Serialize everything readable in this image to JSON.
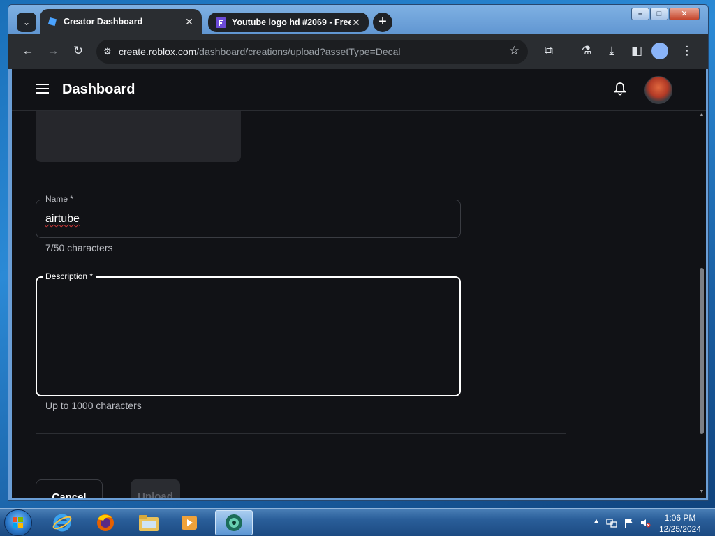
{
  "browser": {
    "tabs": [
      {
        "title": "Creator Dashboard",
        "active": true
      },
      {
        "title": "Youtube logo hd #2069 - Free",
        "active": false
      }
    ],
    "url_host": "create.roblox.com",
    "url_path": "/dashboard/creations/upload?assetType=Decal"
  },
  "header": {
    "title": "Dashboard"
  },
  "form": {
    "name_label": "Name *",
    "name_value": "airtube",
    "name_helper": "7/50 characters",
    "description_label": "Description *",
    "description_value": "",
    "description_helper": "Up to 1000 characters",
    "cancel_label": "Cancel",
    "upload_label": "Upload"
  },
  "taskbar": {
    "time": "1:06 PM",
    "date": "12/25/2024"
  },
  "colors": {
    "page_bg": "#111216",
    "toolbar_bg": "#2a2d31",
    "accent_white": "#ffffff"
  }
}
